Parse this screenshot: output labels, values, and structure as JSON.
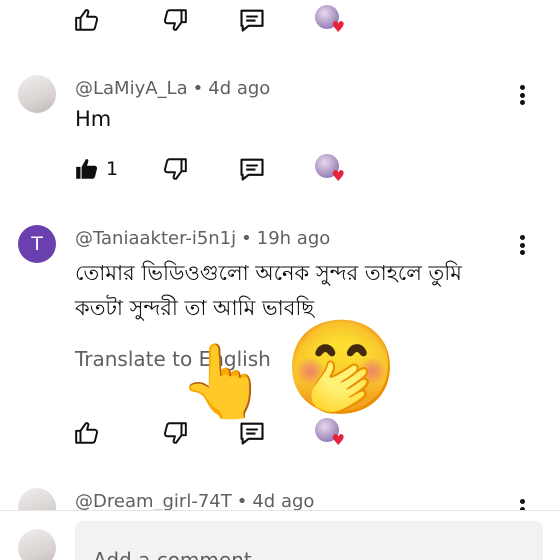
{
  "comments": [
    {
      "author": "@LaMiyA_La",
      "separator": "•",
      "time": "4d ago",
      "text_lines": [
        "Hm"
      ],
      "like_count": "1"
    },
    {
      "author": "@Taniaakter-i5n1j",
      "separator": "•",
      "time": "19h ago",
      "avatar_letter": "T",
      "text_lines": [
        "তোমার ভিডিওগুলো অনেক সুন্দর তাহলে তুমি",
        "কতটা সুন্দরী তা  আমি ভাবছি"
      ],
      "translate_label": "Translate to English"
    },
    {
      "author": "@Dream_girl-74T",
      "separator": "•",
      "time": "4d ago"
    }
  ],
  "overlay": {
    "pointer": "👆",
    "laugh": "🤭"
  },
  "composer": {
    "placeholder": "Add a comment..."
  },
  "icons": {
    "like": "thumb-up-icon",
    "dislike": "thumb-down-icon",
    "reply": "reply-icon",
    "heart": "♥"
  },
  "colors": {
    "letter_avatar": "#6a3fb0",
    "heart": "#e8223d",
    "secondary_text": "#606060"
  }
}
